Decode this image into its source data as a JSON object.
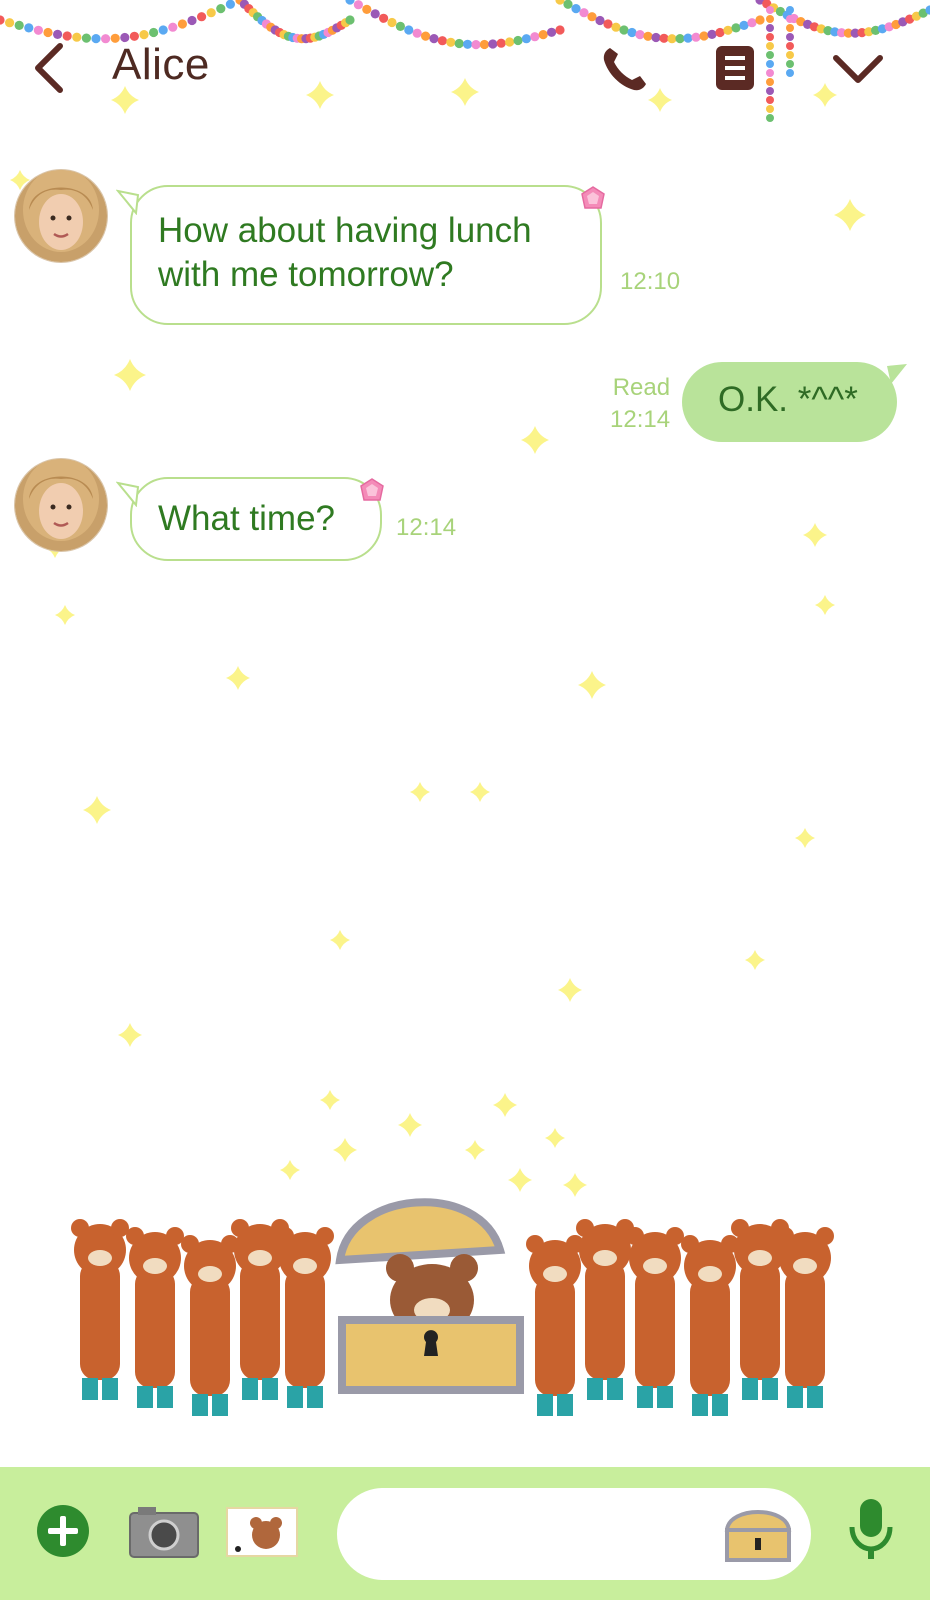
{
  "header": {
    "title": "Alice"
  },
  "messages": [
    {
      "direction": "incoming",
      "sender": "Alice",
      "text_line1": "How about having lunch",
      "text_line2": "with me tomorrow?",
      "time": "12:10"
    },
    {
      "direction": "outgoing",
      "text": "O.K. *^^*",
      "status": "Read",
      "time": "12:14"
    },
    {
      "direction": "incoming",
      "sender": "Alice",
      "text": "What time?",
      "time": "12:14"
    }
  ],
  "footer": {
    "input_placeholder": ""
  },
  "colors": {
    "header_icon": "#5b2a24",
    "bubble_border": "#b9df8d",
    "incoming_text": "#2f7a21",
    "outgoing_bubble": "#b9e39a",
    "timestamp": "#a8d37a",
    "footer_bg": "#c8ee9c",
    "plus_button": "#2e8b2e"
  },
  "icons": [
    "back-arrow-icon",
    "phone-icon",
    "menu-list-icon",
    "chevron-down-icon",
    "plus-icon",
    "camera-icon",
    "sticker-thumbnail-icon",
    "treasure-chest-sticker-icon",
    "microphone-icon"
  ]
}
